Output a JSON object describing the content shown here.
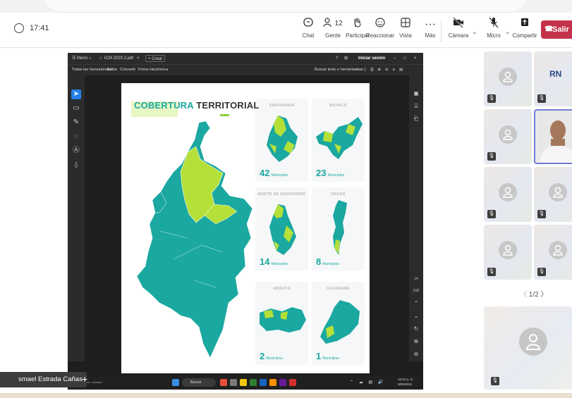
{
  "meeting": {
    "timer": "17:41",
    "toolbar": {
      "chat": "Chat",
      "people": "Gente",
      "people_count": "12",
      "raise": "Participar",
      "react": "Reaccionar",
      "view": "Vista",
      "more": "Más",
      "camera": "Cámara",
      "mic": "Micro",
      "share": "Compartir",
      "leave": "Salir"
    },
    "presenter_name": "smael Estrada Cañas",
    "pager": "1/2",
    "participant_initials": "RN"
  },
  "acrobat": {
    "menu_label": "Menú",
    "tab": "ICM 2023 2.pdf",
    "new_tab": "Crear",
    "sign_in": "Iniciar sesión",
    "menu_items": [
      "Todas las herramientas",
      "Editar",
      "Convertir",
      "Firma electrónica"
    ],
    "search_tools": "Buscar texto o herramientas",
    "page_num": "14",
    "page_total": "218"
  },
  "windows_taskbar": {
    "search": "Buscar",
    "time": "10:24 a. m.",
    "date": "3/06/2024",
    "weather": "Mayorm. soleado"
  },
  "slide": {
    "title_part1": "COBERTURA",
    "title_part2": "TERRITORIAL",
    "panels": [
      {
        "name": "SANTANDER",
        "count": "42",
        "unit": "Municipios"
      },
      {
        "name": "BOYACÁ",
        "count": "23",
        "unit": "Municipios"
      },
      {
        "name": "NORTE DE SANTANDER",
        "count": "14",
        "unit": "Municipios"
      },
      {
        "name": "CESAR",
        "count": "8",
        "unit": "Municipios"
      },
      {
        "name": "ARAUCA",
        "count": "2",
        "unit": "Municipios"
      },
      {
        "name": "CASANARE",
        "count": "1",
        "unit": "Municipios"
      }
    ]
  },
  "colors": {
    "map_teal": "#1aa8a0",
    "map_lime": "#b5e03a",
    "leave_red": "#c4314b",
    "acrobat_blue": "#2680eb"
  }
}
